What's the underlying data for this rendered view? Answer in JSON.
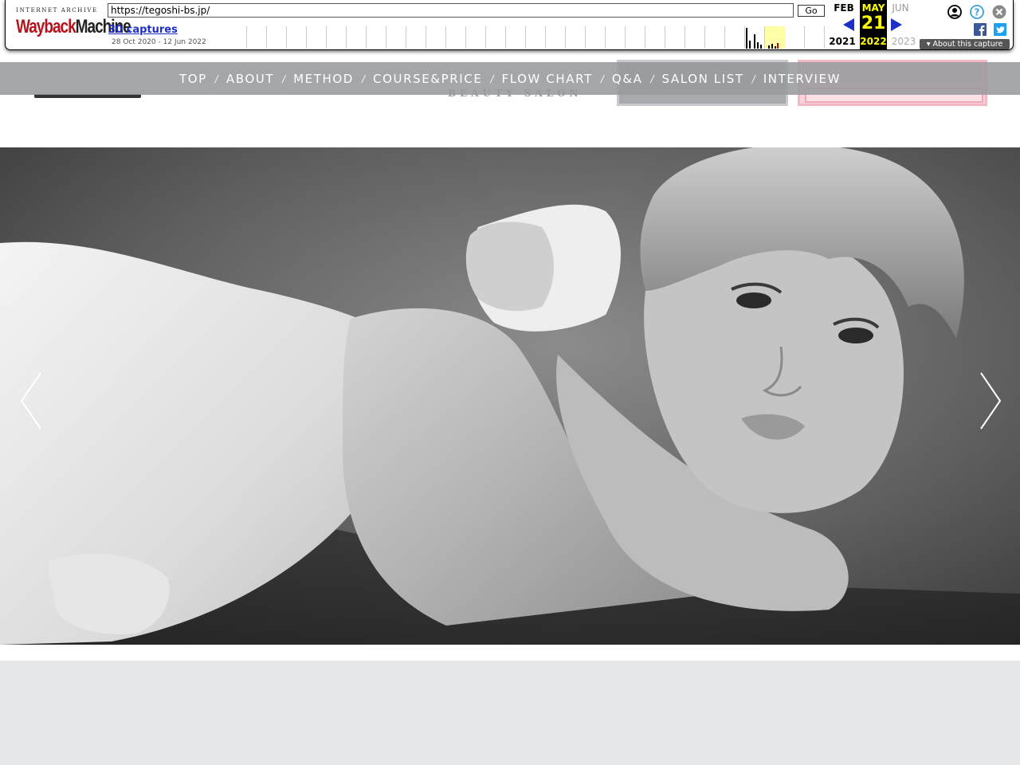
{
  "wayback": {
    "logo_top": "INTERNET ARCHIVE",
    "logo_main_red": "Wayback",
    "logo_main_dark": "Machine",
    "url": "https://tegoshi-bs.jp/",
    "go_label": "Go",
    "captures_label": "30 captures",
    "date_range": "28 Oct 2020 - 12 Jun 2022",
    "calendar": {
      "prev_month": "FEB",
      "current_month": "MAY",
      "next_month": "JUN",
      "current_day": "21",
      "prev_year": "2021",
      "current_year": "2022",
      "next_year": "2023"
    },
    "about_label": "About this capture",
    "colors": {
      "highlight": "#ffff00",
      "link": "#1e2fc7",
      "logo_red": "#b5121b"
    }
  },
  "site": {
    "tagline": "BEAUTY SALON"
  },
  "nav": {
    "items": [
      "TOP",
      "ABOUT",
      "METHOD",
      "COURSE&PRICE",
      "FLOW CHART",
      "Q&A",
      "SALON LIST",
      "INTERVIEW"
    ],
    "separator": "/"
  },
  "icons": {
    "user": "user-circle-icon",
    "help": "help-icon",
    "close": "close-icon",
    "facebook": "facebook-icon",
    "twitter": "twitter-icon",
    "prev": "chevron-left-icon",
    "next": "chevron-right-icon"
  }
}
